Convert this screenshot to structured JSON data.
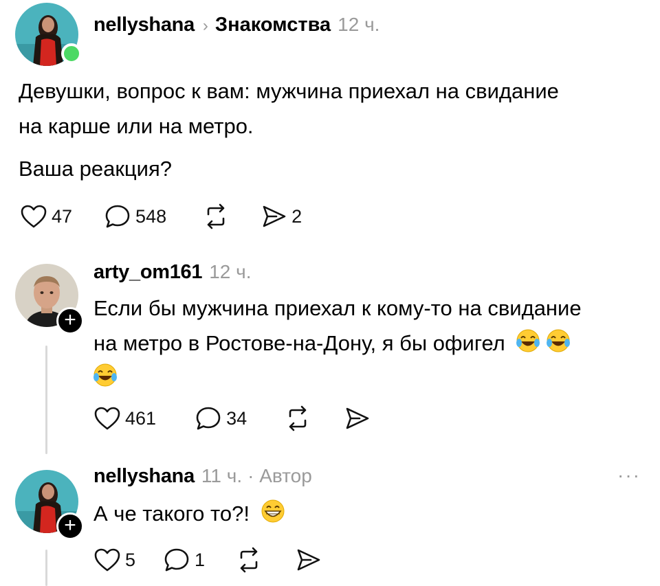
{
  "post": {
    "username": "nellyshana",
    "community": "Знакомства",
    "time": "12 ч.",
    "text_line1": "Девушки, вопрос к вам: мужчина приехал на свидание",
    "text_line2": "на карше или на метро.",
    "text_line3": "Ваша реакция?",
    "likes": "47",
    "comments": "548",
    "shares": "2",
    "online_color": "#4cd964"
  },
  "reply1": {
    "username": "arty_om161",
    "time": "12 ч.",
    "text_line1": "Если бы мужчина приехал к кому-то на свидание",
    "text_line2": "на метро в Ростове-на-Дону, я бы офигел",
    "emoji": "face-with-tears-of-joy",
    "likes": "461",
    "comments": "34"
  },
  "reply2": {
    "username": "nellyshana",
    "time": "11 ч.",
    "author_tag": "· Автор",
    "text": "А че такого то?!",
    "emoji": "grinning-face",
    "likes": "5",
    "comments": "1",
    "more": "···"
  }
}
